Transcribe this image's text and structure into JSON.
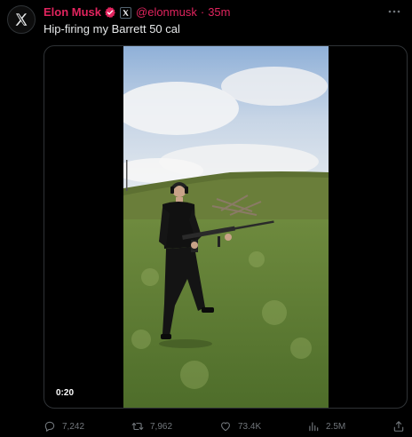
{
  "author": {
    "name": "Elon Musk",
    "handle": "@elonmusk",
    "time": "35m",
    "separator": "·"
  },
  "post": {
    "text": "Hip-firing my Barrett 50 cal"
  },
  "video": {
    "duration": "0:20"
  },
  "metrics": {
    "replies": "7,242",
    "reposts": "7,962",
    "likes": "73.4K",
    "views": "2.5M"
  },
  "colors": {
    "background": "#000000",
    "username_accent": "#e0245e",
    "secondary_text": "#71767b",
    "verified": "#e0245e"
  },
  "icons": {
    "avatar": "x-logo-icon",
    "verified": "verified-badge-icon",
    "affiliation": "x-affiliation-icon",
    "more": "more-horizontal-icon",
    "reply": "reply-icon",
    "repost": "repost-icon",
    "like": "heart-icon",
    "views": "views-icon",
    "share": "share-icon"
  }
}
